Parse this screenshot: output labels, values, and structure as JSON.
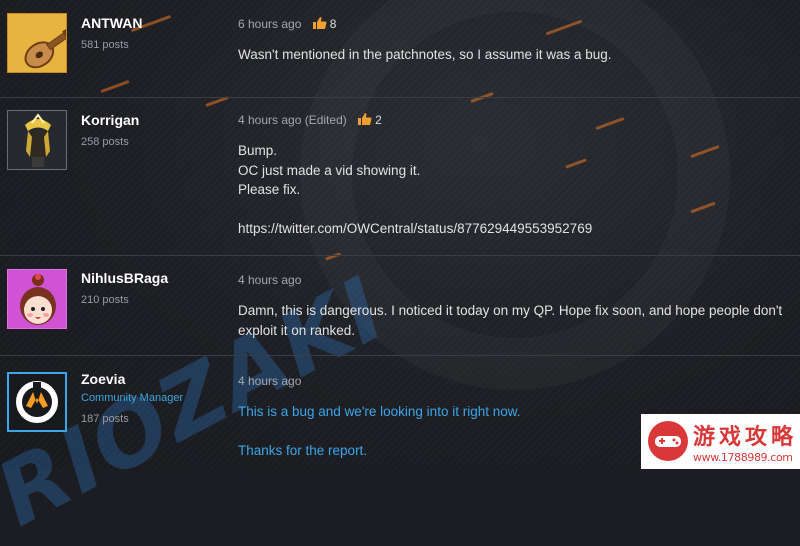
{
  "posts": [
    {
      "username": "ANTWAN",
      "post_count": "581 posts",
      "time": "6 hours ago",
      "likes": "8",
      "lines": [
        "Wasn't mentioned in the patchnotes, so I assume it was a bug."
      ]
    },
    {
      "username": "Korrigan",
      "post_count": "258 posts",
      "time": "4 hours ago (Edited)",
      "likes": "2",
      "lines": [
        "Bump.",
        "OC just made a vid showing it.",
        "Please fix.",
        "",
        "https://twitter.com/OWCentral/status/877629449553952769"
      ]
    },
    {
      "username": "NihlusBRaga",
      "post_count": "210 posts",
      "time": "4 hours ago",
      "lines": [
        "Damn, this is dangerous. I noticed it today on my QP. Hope fix soon, and hope people don't exploit it on ranked."
      ]
    },
    {
      "username": "Zoevia",
      "role": "Community Manager",
      "post_count": "187 posts",
      "time": "4 hours ago",
      "lines": [
        "This is a bug and we're looking into it right now.",
        "",
        "Thanks for the report."
      ]
    }
  ],
  "watermark": {
    "background_text": "RIOZAKI",
    "logo_text": "游戏攻略",
    "logo_url": "www.1788989.com"
  },
  "colors": {
    "accent_orange": "#f0a030",
    "blizzard_blue": "#3ca6e8",
    "background": "#1b1d22"
  }
}
